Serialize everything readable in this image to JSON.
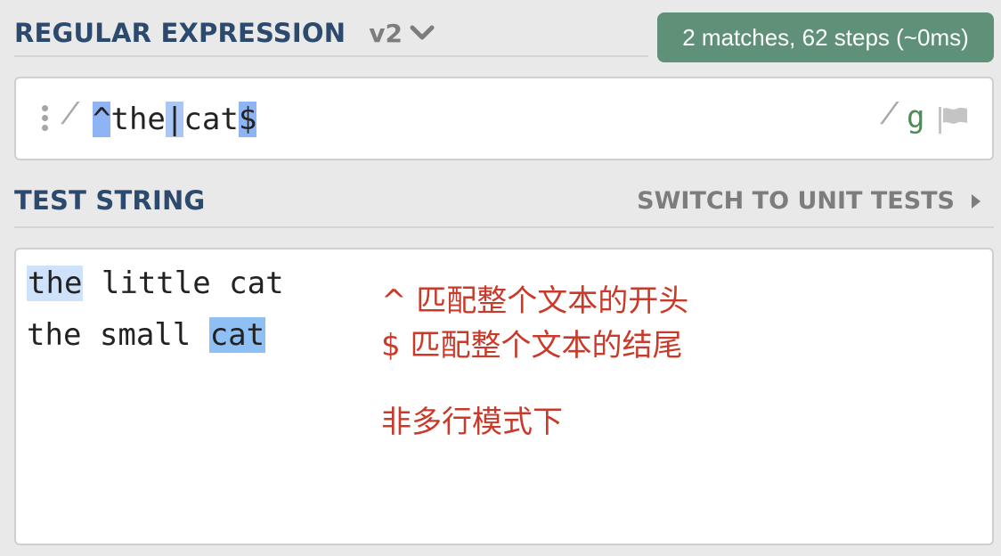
{
  "header": {
    "title": "REGULAR EXPRESSION",
    "flavor": "v2",
    "match_info": "2 matches, 62 steps (~0ms)"
  },
  "regex": {
    "open_delimiter": "/",
    "tokens": [
      "^",
      "the",
      "|",
      "cat",
      "$"
    ],
    "close_delimiter": "/",
    "flags": "g"
  },
  "test_string": {
    "title": "TEST STRING",
    "switch_label": "SWITCH TO UNIT TESTS",
    "lines": [
      {
        "parts": [
          "the",
          " little cat"
        ]
      },
      {
        "parts": [
          "the small ",
          "cat"
        ]
      }
    ],
    "notes": [
      "^ 匹配整个文本的开头",
      "$ 匹配整个文本的结尾",
      "非多行模式下"
    ]
  },
  "colors": {
    "title": "#2c4a6e",
    "badge": "#5e9177",
    "note": "#c93a2a",
    "match_1": "#cfe2fb",
    "match_2": "#8fc0f3"
  },
  "icons": {
    "flavor_dropdown": "chevron-down-icon",
    "drag": "drag-handle-icon",
    "flag": "flag-icon",
    "switch": "triangle-right-icon"
  }
}
